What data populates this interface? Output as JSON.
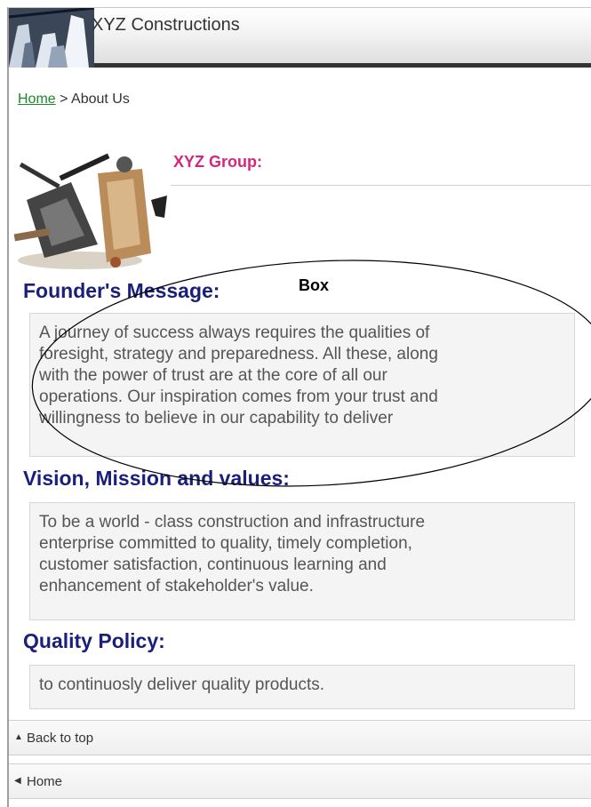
{
  "header": {
    "site_title": "XYZ Constructions"
  },
  "breadcrumb": {
    "home_link": "Home",
    "separator": " > ",
    "current": "About Us"
  },
  "company": {
    "name": "XYZ Group:"
  },
  "annotation": {
    "label": "Box"
  },
  "sections": [
    {
      "heading": "Founder's Message:",
      "body_lines": [
        "A journey of success always requires the qualities of",
        "foresight, strategy and preparedness. All these, along",
        "with the power of trust are at the core of all our",
        "operations. Our inspiration comes from your trust and",
        "willingness to believe in our capability to deliver"
      ]
    },
    {
      "heading": "Vision, Mission and values:",
      "body_lines": [
        "To be a world - class construction and infrastructure",
        "enterprise committed to quality, timely completion,",
        "customer satisfaction, continuous learning and",
        "enhancement of stakeholder's value."
      ]
    },
    {
      "heading": "Quality Policy:",
      "body_lines": [
        "to continuosly deliver quality products."
      ]
    }
  ],
  "footer_nav": {
    "back_to_top": {
      "icon": "triangle-up-icon",
      "label": "Back to top"
    },
    "home": {
      "icon": "triangle-left-icon",
      "label": "Home"
    }
  },
  "colors": {
    "heading": "#1a1f7a",
    "company_name": "#d4267c",
    "link": "#1a8a2a",
    "box_bg": "#f4f4f4"
  }
}
